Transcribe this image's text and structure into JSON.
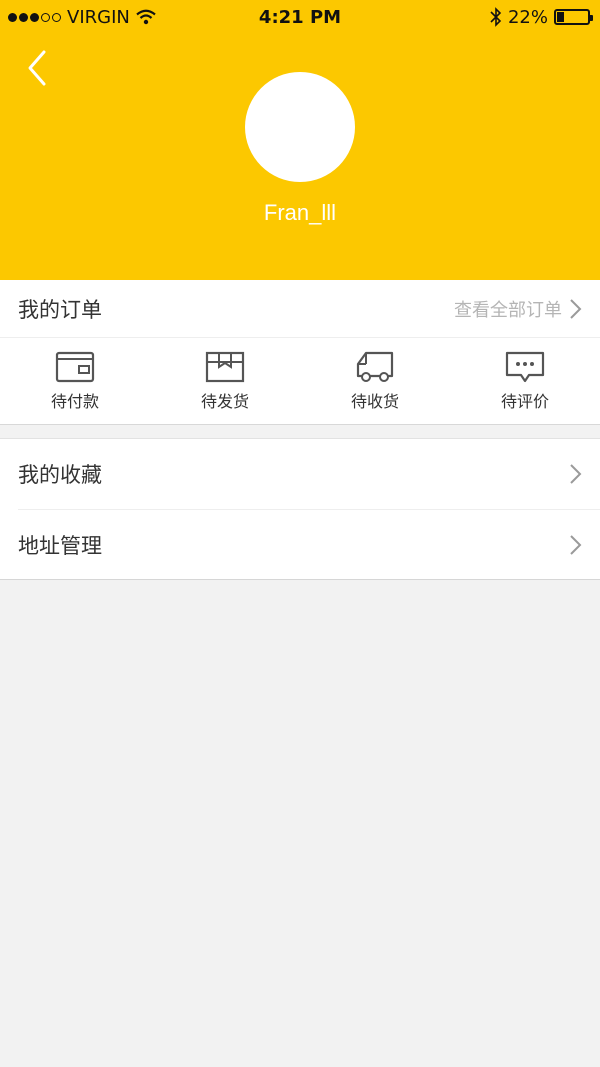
{
  "status_bar": {
    "carrier": "VIRGIN",
    "time": "4:21 PM",
    "battery": "22%",
    "battery_level": 0.22,
    "icons": [
      "wifi-icon",
      "bluetooth-icon",
      "battery-icon"
    ]
  },
  "profile": {
    "username": "Fran_lll"
  },
  "orders": {
    "title": "我的订单",
    "view_all": "查看全部订单",
    "tabs": [
      {
        "label": "待付款",
        "icon": "wallet-icon"
      },
      {
        "label": "待发货",
        "icon": "box-icon"
      },
      {
        "label": "待收货",
        "icon": "truck-icon"
      },
      {
        "label": "待评价",
        "icon": "comment-icon"
      }
    ]
  },
  "menu": {
    "items": [
      {
        "label": "我的收藏"
      },
      {
        "label": "地址管理"
      }
    ]
  },
  "colors": {
    "header_bg": "#fcc800",
    "page_bg": "#f2f2f2"
  }
}
